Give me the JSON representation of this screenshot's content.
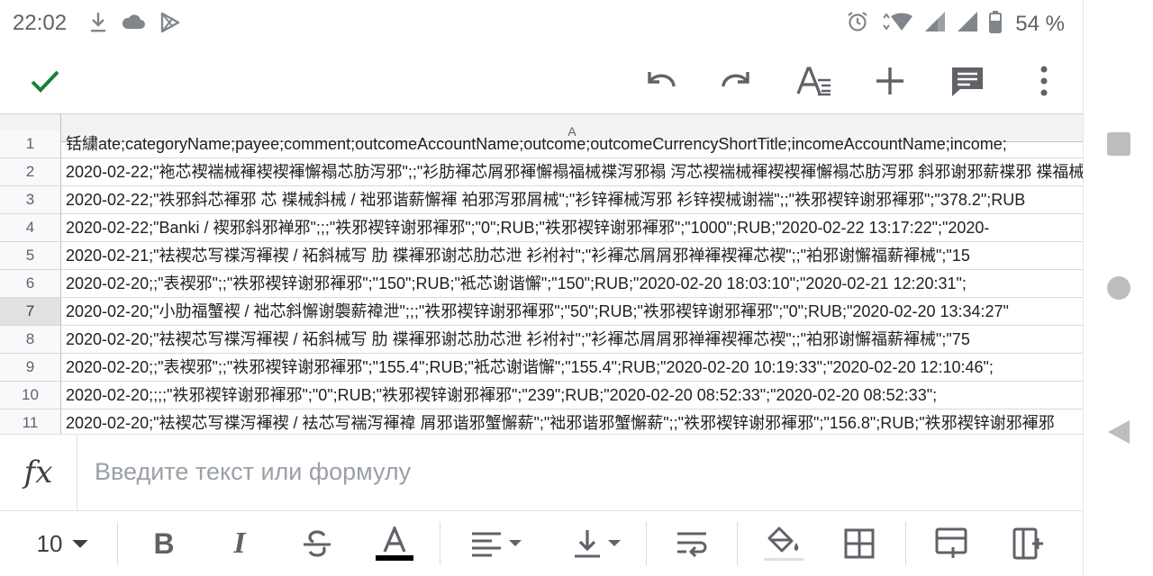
{
  "status_bar": {
    "time": "22:02",
    "icons_left": [
      "download-icon",
      "cloud-icon",
      "play-store-icon"
    ],
    "icons_right": [
      "alarm-icon",
      "wifi-icon",
      "signal-icon",
      "signal-icon",
      "battery-icon"
    ],
    "battery": "54 %"
  },
  "toolbar": {
    "icons": [
      "check-icon",
      "undo-icon",
      "redo-icon",
      "text-format-icon",
      "add-icon",
      "comment-icon",
      "more-vert-icon"
    ]
  },
  "grid": {
    "column_header": "A",
    "selected_row": "7",
    "rows": [
      {
        "num": "1",
        "text": "铦繍ate;categoryName;payee;comment;outcomeAccountName;outcome;outcomeCurrencyShortTitle;incomeAccountName;income;"
      },
      {
        "num": "2",
        "text": "2020-02-22;\"袘芯褉褍械褌褉褉褌懈褟芯肪泻邪\";;\"衫肪褌芯屑邪褌懈褟福械褋泻邪褟 泻芯褉褍械褌褉褉褌懈褟芯肪泻邪 斜邪谢邪薪褋邪 褋福械褋\""
      },
      {
        "num": "3",
        "text": "2020-02-22;\"袟邪斜芯褌邪 芯 褋械斜械 / 袦邪谐薪懈褌 袙邪泻邪屑械\";\"衫锌褌械泻邪 衫锌褉械谢褍\";;\"袟邪褉锌谢邪褌邪\";\"378.2\";RUB"
      },
      {
        "num": "4",
        "text": "2020-02-22;\"Banki / 褉邪斜邪褝邪\";;;\"袟邪褉锌谢邪褌邪\";\"0\";RUB;\"袟邪褉锌谢邪褌邪\";\"1000\";RUB;\"2020-02-22 13:17:22\";\"2020-"
      },
      {
        "num": "5",
        "text": "2020-02-21;\"袪褉芯写褋泻褌褉 / 袥斜械写 肋 褋褌邪谢芯肋芯泄 衫袝衬\";\"衫褌芯屑屑邪褝褌褉褌芯褉\";;\"袙邪谢懈福薪褌械\";\"15"
      },
      {
        "num": "6",
        "text": "2020-02-20;;\"表褉邪\";;\"袟邪褉锌谢邪褌邪\";\"150\";RUB;\"袛芯谢谐懈\";\"150\";RUB;\"2020-02-20 18:03:10\";\"2020-02-21 12:20:31\";"
      },
      {
        "num": "7",
        "text": "2020-02-20;\"小肋福蟹褉 / 袦芯斜懈谢褜薪褘泄\";;;\"袟邪褉锌谢邪褌邪\";\"50\";RUB;\"袟邪褉锌谢邪褌邪\";\"0\";RUB;\"2020-02-20 13:34:27\""
      },
      {
        "num": "8",
        "text": "2020-02-20;\"袪褉芯写褋泻褌褉 / 袥斜械写 肋 褋褌邪谢芯肋芯泄 衫袝衬\";\"衫褌芯屑屑邪褝褌褉褌芯褉\";;\"袙邪谢懈福薪褌械\";\"75"
      },
      {
        "num": "9",
        "text": "2020-02-20;;\"表褉邪\";;\"袟邪褉锌谢邪褌邪\";\"155.4\";RUB;\"袛芯谢谐懈\";\"155.4\";RUB;\"2020-02-20 10:19:33\";\"2020-02-20 12:10:46\";"
      },
      {
        "num": "10",
        "text": "2020-02-20;;;;\"袟邪褉锌谢邪褌邪\";\"0\";RUB;\"袟邪褉锌谢邪褌邪\";\"239\";RUB;\"2020-02-20 08:52:33\";\"2020-02-20 08:52:33\";"
      },
      {
        "num": "11",
        "text": "2020-02-20;\"袪褉芯写褋泻褌褉 / 袪芯写褍泻褌褘 屑邪谐邪蟹懈薪\";\"袦邪谐邪蟹懈薪\";;\"袟邪褉锌谢邪褌邪\";\"156.8\";RUB;\"袟邪褉锌谢邪褌邪"
      }
    ]
  },
  "formula_bar": {
    "fx_label": "fx",
    "placeholder": "Введите текст или формулу"
  },
  "format_bar": {
    "font_size": "10",
    "text_color": "#000000"
  },
  "colors": {
    "accent_green": "#188038",
    "icon_gray": "#5f6368",
    "header_bg": "#f1f3f4"
  }
}
